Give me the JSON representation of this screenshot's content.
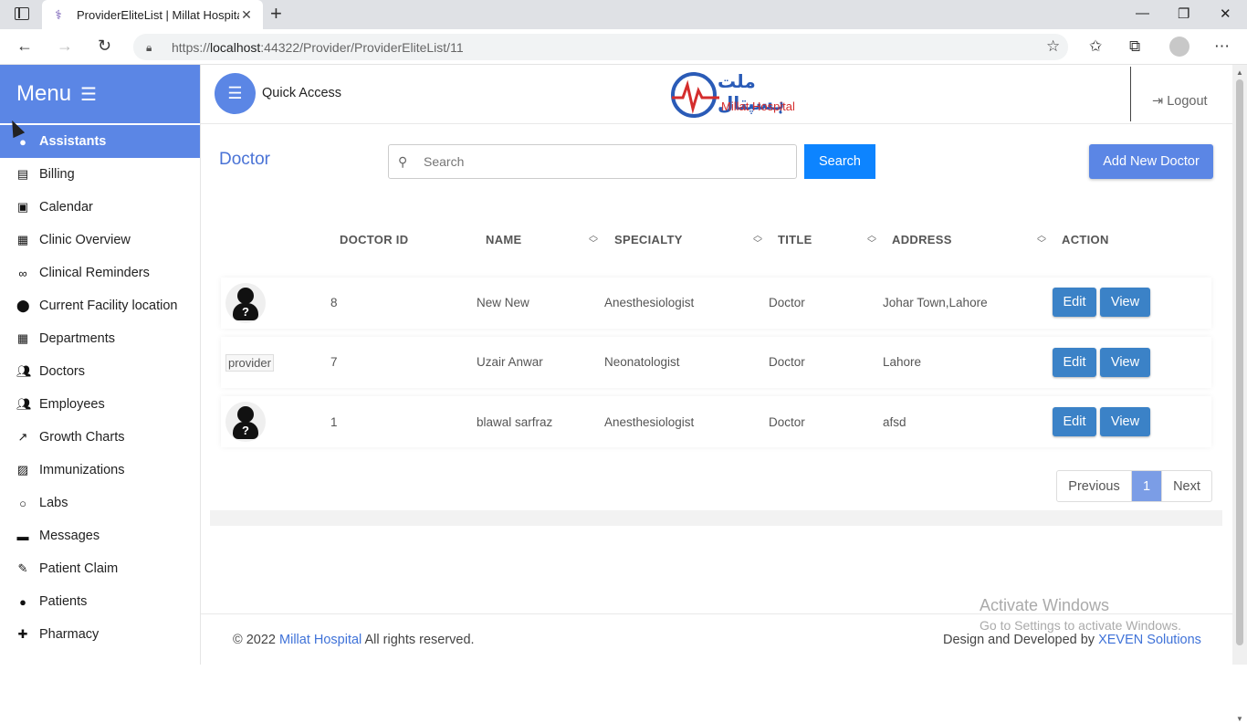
{
  "browser": {
    "tab_title": "ProviderEliteList | Millat Hospital",
    "url_prefix": "https://",
    "url_host": "localhost",
    "url_rest": ":44322/Provider/ProviderEliteList/11"
  },
  "sidebar": {
    "menu_label": "Menu",
    "items": [
      {
        "label": "Assistants",
        "icon": "person-icon"
      },
      {
        "label": "Billing",
        "icon": "clipboard-icon"
      },
      {
        "label": "Calendar",
        "icon": "calendar-icon"
      },
      {
        "label": "Clinic Overview",
        "icon": "building-icon"
      },
      {
        "label": "Clinical Reminders",
        "icon": "link-icon"
      },
      {
        "label": "Current Facility location",
        "icon": "location-pin-icon"
      },
      {
        "label": "Departments",
        "icon": "building-icon"
      },
      {
        "label": "Doctors",
        "icon": "people-icon"
      },
      {
        "label": "Employees",
        "icon": "people-icon"
      },
      {
        "label": "Growth Charts",
        "icon": "trending-up-icon"
      },
      {
        "label": "Immunizations",
        "icon": "hatch-icon"
      },
      {
        "label": "Labs",
        "icon": "circle-icon"
      },
      {
        "label": "Messages",
        "icon": "message-icon"
      },
      {
        "label": "Patient Claim",
        "icon": "pencil-icon"
      },
      {
        "label": "Patients",
        "icon": "person-icon"
      },
      {
        "label": "Pharmacy",
        "icon": "pharmacy-icon"
      }
    ]
  },
  "header": {
    "quick_access": "Quick Access",
    "logo_urdu": "ملت ہسپتال",
    "logo_english": "Millat Hospital",
    "logout": "Logout"
  },
  "main": {
    "title": "Doctor",
    "search_placeholder": "Search",
    "search_button": "Search",
    "add_button": "Add New Doctor",
    "columns": [
      "DOCTOR ID",
      "NAME",
      "SPECIALTY",
      "TITLE",
      "ADDRESS",
      "ACTION"
    ],
    "rows": [
      {
        "id": "8",
        "name": "New New",
        "specialty": "Anesthesiologist",
        "title": "Doctor",
        "address": "Johar Town,Lahore",
        "image": "avatar"
      },
      {
        "id": "7",
        "name": "Uzair Anwar",
        "specialty": "Neonatologist",
        "title": "Doctor",
        "address": "Lahore",
        "image": "broken",
        "image_alt": "provider"
      },
      {
        "id": "1",
        "name": "blawal sarfraz",
        "specialty": "Anesthesiologist",
        "title": "Doctor",
        "address": "afsd",
        "image": "avatar"
      }
    ],
    "edit_label": "Edit",
    "view_label": "View",
    "pagination": {
      "previous": "Previous",
      "current": "1",
      "next": "Next"
    }
  },
  "footer": {
    "copyright_prefix": "© 2022",
    "brand": "Millat Hospital",
    "copyright_suffix": "All rights reserved.",
    "design_prefix": "Design and Developed by",
    "company": "XEVEN Solutions"
  },
  "watermark": {
    "line1": "Activate Windows",
    "line2": "Go to Settings to activate Windows."
  }
}
